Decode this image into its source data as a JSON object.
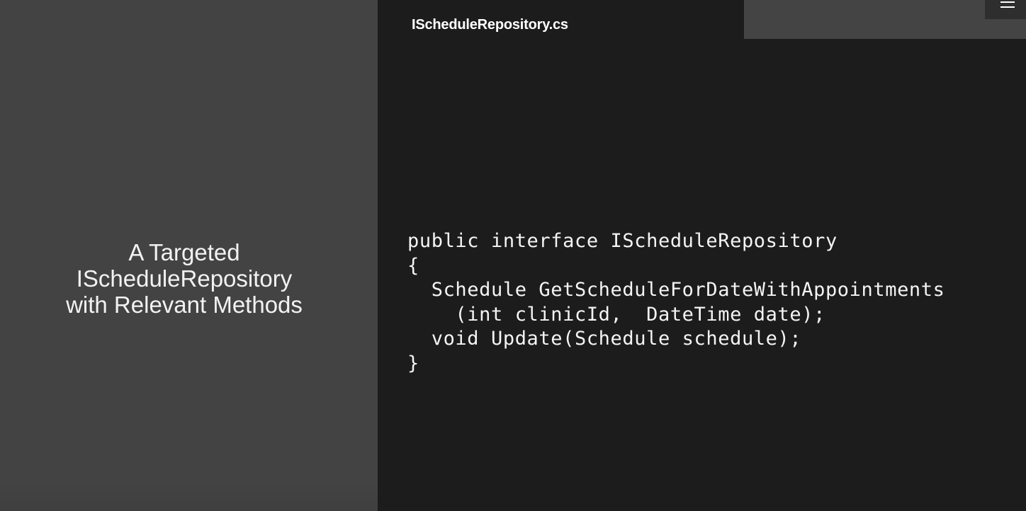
{
  "slide": {
    "title_lines": [
      "A Targeted",
      "IScheduleRepository",
      "with Relevant Methods"
    ],
    "file_name": "IScheduleRepository.cs",
    "code_lines": [
      "public interface IScheduleRepository",
      "{",
      "  Schedule GetScheduleForDateWithAppointments",
      "    (int clinicId,  DateTime date);",
      "  void Update(Schedule schedule);",
      "}"
    ]
  },
  "controls": {
    "menu_icon": "hamburger-menu-icon"
  },
  "colors": {
    "left_panel": "#434343",
    "right_panel": "#1c1c1c",
    "top_bar": "#444444",
    "text": "#f2f2f2"
  }
}
